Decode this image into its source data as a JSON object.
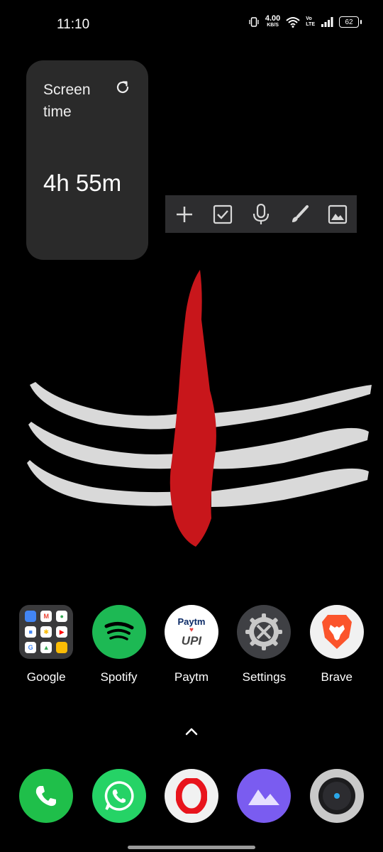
{
  "status_bar": {
    "time": "11:10",
    "net_speed_value": "4.00",
    "net_speed_unit": "KB/S",
    "volte_top": "Vo",
    "volte_bottom": "LTE",
    "battery_level": "62"
  },
  "widget": {
    "title": "Screen time",
    "value": "4h 55m"
  },
  "note_toolbar": {
    "items": [
      "plus-icon",
      "checkbox-icon",
      "microphone-icon",
      "brush-icon",
      "image-icon"
    ]
  },
  "apps": [
    {
      "label": "Google",
      "icon": "google-folder"
    },
    {
      "label": "Spotify",
      "icon": "spotify-icon"
    },
    {
      "label": "Paytm",
      "icon": "paytm-icon"
    },
    {
      "label": "Settings",
      "icon": "settings-icon"
    },
    {
      "label": "Brave",
      "icon": "brave-icon"
    }
  ],
  "paytm_logo": {
    "top": "Paytm",
    "bottom": "UPI"
  },
  "dock": [
    "phone-icon",
    "whatsapp-icon",
    "opera-icon",
    "gallery-icon",
    "camera-icon"
  ],
  "colors": {
    "widget_bg": "#2a2a2a",
    "spotify": "#1db954",
    "phone": "#1fbf4a",
    "whatsapp": "#25d366",
    "opera": "#e8141c",
    "brave": "#fb542b",
    "gallery": "#7a5cf0"
  }
}
